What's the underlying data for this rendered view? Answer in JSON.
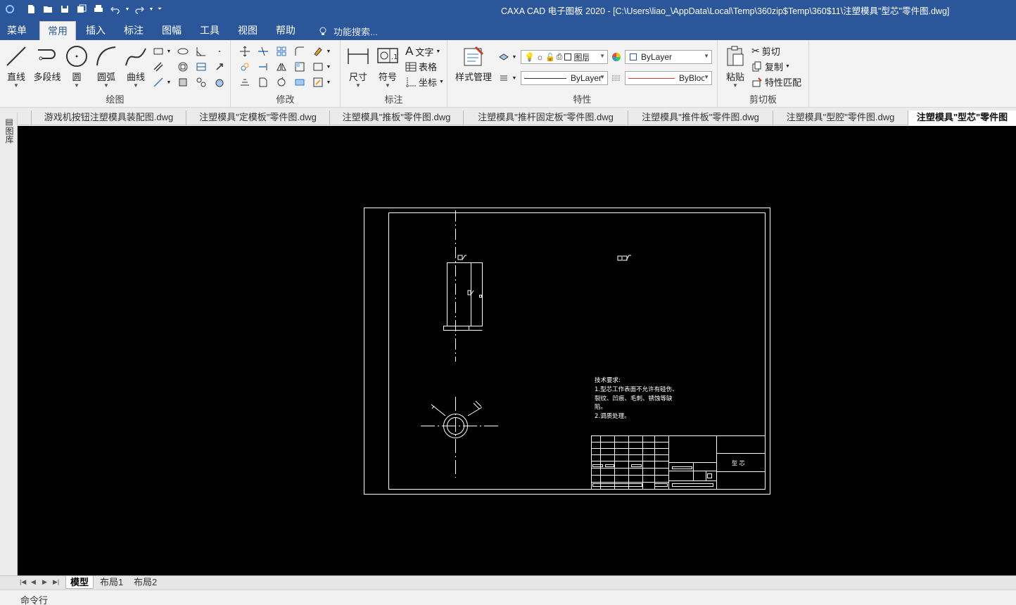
{
  "window": {
    "title": "CAXA CAD 电子图板 2020 - [C:\\Users\\liao_\\AppData\\Local\\Temp\\360zip$Temp\\360$11\\注塑模具\"型芯\"零件图.dwg]"
  },
  "menu_tabs": [
    {
      "label": "菜单"
    },
    {
      "label": "常用"
    },
    {
      "label": "插入"
    },
    {
      "label": "标注"
    },
    {
      "label": "图幅"
    },
    {
      "label": "工具"
    },
    {
      "label": "视图"
    },
    {
      "label": "帮助"
    }
  ],
  "search": {
    "placeholder": "功能搜索..."
  },
  "ribbon": {
    "draw": {
      "label": "绘图",
      "line": "直线",
      "polyline": "多段线",
      "circle": "圆",
      "arc": "圆弧",
      "curve": "曲线"
    },
    "modify": {
      "label": "修改"
    },
    "annotate": {
      "label": "标注",
      "dimension": "尺寸",
      "symbol": "符号",
      "text": "文字",
      "table": "表格",
      "coordinate": "坐标"
    },
    "properties": {
      "label": "特性",
      "style_manager": "样式管理",
      "layer_value": "图层",
      "color_value": "ByLayer",
      "linetype_value": "ByLayer",
      "lineweight_value": "ByBlock"
    },
    "clipboard": {
      "label": "剪切板",
      "paste": "粘贴",
      "cut": "剪切",
      "copy": "复制",
      "match": "特性匹配"
    }
  },
  "doc_tabs": [
    {
      "label": "游戏机按钮注塑模具装配图.dwg"
    },
    {
      "label": "注塑模具\"定模板\"零件图.dwg"
    },
    {
      "label": "注塑模具\"推板\"零件图.dwg"
    },
    {
      "label": "注塑模具\"推杆固定板\"零件图.dwg"
    },
    {
      "label": "注塑模具\"推件板\"零件图.dwg"
    },
    {
      "label": "注塑模具\"型腔\"零件图.dwg"
    },
    {
      "label": "注塑模具\"型芯\"零件图"
    }
  ],
  "side_panel": {
    "label": "图库"
  },
  "drawing": {
    "tech_title": "技术要求:",
    "tech_line1": "1.型芯工作表面不允许有碰伤、",
    "tech_line2": "裂纹、凹痕、毛刺、锈蚀等缺",
    "tech_line3": "陷。",
    "tech_line4": "2.调质处理。",
    "part_name": "型 芯"
  },
  "layout_tabs": [
    {
      "label": "模型"
    },
    {
      "label": "布局1"
    },
    {
      "label": "布局2"
    }
  ],
  "command_line": {
    "label": "命令行"
  }
}
